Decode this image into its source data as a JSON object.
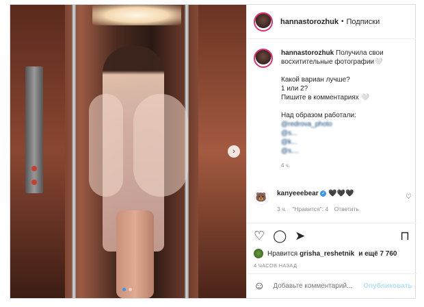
{
  "post": {
    "username": "hannastorozhuk",
    "separator": "•",
    "follow_label": "Подписки"
  },
  "caption": {
    "username": "hannastorozhuk",
    "line1": "Получила свои",
    "line2": "восхитительные фотографии🤍",
    "line3": "Какой вариан лучше?",
    "line4": "1 или 2?",
    "line5": "Пишите в комментариях 🤍",
    "line6": "Над образом работали:",
    "mentions": [
      "@redrova_photo",
      "@s...",
      "@k...",
      "@s...."
    ],
    "time": "4 ч."
  },
  "comment": {
    "username": "kanyeeebear",
    "verified_icon": "✓",
    "text": "🖤🖤🖤",
    "time": "3 ч.",
    "likes": "\"Нравится\": 4",
    "reply": "Ответить"
  },
  "likes": {
    "prefix": "Нравится",
    "user": "grisha_reshetnik",
    "suffix": "и ещё 7 760"
  },
  "date": "4 ЧАСОВ НАЗАД",
  "add_comment": {
    "placeholder": "Добавьте комментарий...",
    "publish": "Опубликовать"
  },
  "icons": {
    "next": "›",
    "heart": "♡",
    "comment": "◯",
    "share": "➤",
    "save": "⊓",
    "smile": "☺",
    "bear": "🐻"
  },
  "colors": {
    "accent": "#3897f0",
    "link": "#00376b",
    "publish_disabled": "#b2dffc"
  }
}
